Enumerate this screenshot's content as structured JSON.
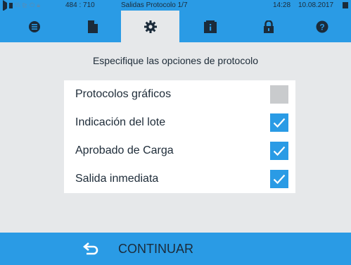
{
  "status_bar": {
    "counter": "484 : 710",
    "title": "Salidas Protocolo 1/7",
    "time": "14:28",
    "date": "10.08.2017"
  },
  "tabs": [
    {
      "icon": "list-icon",
      "active": false
    },
    {
      "icon": "document-icon",
      "active": false
    },
    {
      "icon": "gear-icon",
      "active": true
    },
    {
      "icon": "info-folder-icon",
      "active": false
    },
    {
      "icon": "lock-icon",
      "active": false
    },
    {
      "icon": "help-icon",
      "active": false
    }
  ],
  "prompt": "Especifique las opciones de protocolo",
  "options": [
    {
      "label": "Protocolos gráficos",
      "checked": false
    },
    {
      "label": "Indicación del lote",
      "checked": true
    },
    {
      "label": "Aprobado de Carga",
      "checked": true
    },
    {
      "label": "Salida inmediata",
      "checked": true
    }
  ],
  "footer": {
    "continue_label": "CONTINUAR"
  },
  "colors": {
    "accent": "#2a9be5",
    "background": "#e6e8ea",
    "text": "#1d2b38",
    "checkbox_off": "#c9cbcd"
  }
}
